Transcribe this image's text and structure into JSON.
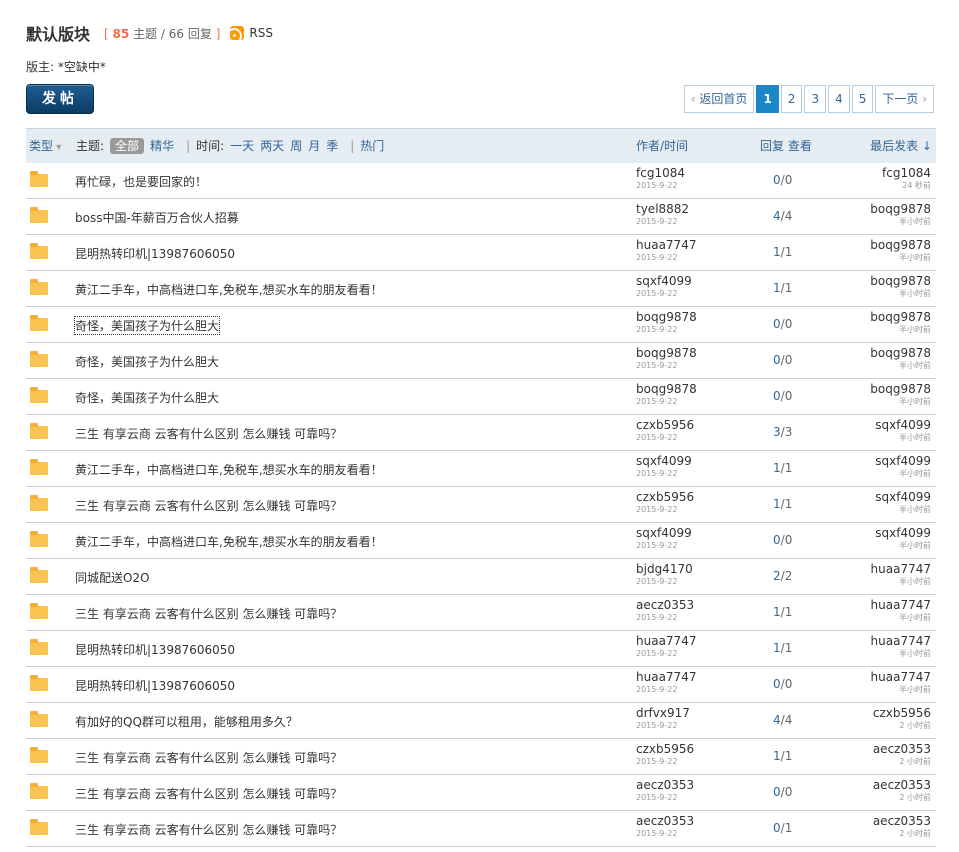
{
  "board": {
    "title": "默认版块",
    "stats_open": "[",
    "threads": "85",
    "threads_label": "主题",
    "stats_sep": "/",
    "replies": "66",
    "replies_label": "回复",
    "stats_close": "]",
    "rss": "RSS",
    "moderator": "版主: *空缺中*"
  },
  "post_button": "发帖",
  "pager": {
    "back": "返回首页",
    "current": "1",
    "pages": [
      "2",
      "3",
      "4",
      "5"
    ],
    "next": "下一页"
  },
  "header": {
    "type": "类型",
    "topic_label": "主题:",
    "all": "全部",
    "digest": "精华",
    "sep1": "|",
    "time_label": "时间:",
    "day": "一天",
    "two_days": "两天",
    "week": "周",
    "month": "月",
    "season": "季",
    "sep2": "|",
    "hot": "热门",
    "author_time": "作者/时间",
    "reply_view": "回复 查看",
    "last_post": "最后发表"
  },
  "rows": [
    {
      "subject": "再忙碌，也是要回家的！",
      "author": "fcg1084",
      "date": "2015-9-22",
      "replies": "0",
      "views": "0",
      "last_user": "fcg1084",
      "last_time": "24 秒前"
    },
    {
      "subject": "boss中国-年薪百万合伙人招募",
      "author": "tyel8882",
      "date": "2015-9-22",
      "replies": "4",
      "views": "4",
      "last_user": "boqg9878",
      "last_time": "半小时前"
    },
    {
      "subject": "昆明热转印机|13987606050",
      "author": "huaa7747",
      "date": "2015-9-22",
      "replies": "1",
      "views": "1",
      "last_user": "boqg9878",
      "last_time": "半小时前"
    },
    {
      "subject": "黄江二手车，中高档进口车,免税车,想买水车的朋友看看！",
      "author": "sqxf4099",
      "date": "2015-9-22",
      "replies": "1",
      "views": "1",
      "last_user": "boqg9878",
      "last_time": "半小时前"
    },
    {
      "subject": "奇怪，美国孩子为什么胆大",
      "author": "boqg9878",
      "date": "2015-9-22",
      "replies": "0",
      "views": "0",
      "last_user": "boqg9878",
      "last_time": "半小时前"
    },
    {
      "subject": "奇怪，美国孩子为什么胆大",
      "author": "boqg9878",
      "date": "2015-9-22",
      "replies": "0",
      "views": "0",
      "last_user": "boqg9878",
      "last_time": "半小时前"
    },
    {
      "subject": "奇怪，美国孩子为什么胆大",
      "author": "boqg9878",
      "date": "2015-9-22",
      "replies": "0",
      "views": "0",
      "last_user": "boqg9878",
      "last_time": "半小时前"
    },
    {
      "subject": "三生 有享云商 云客有什么区别 怎么赚钱 可靠吗？",
      "author": "czxb5956",
      "date": "2015-9-22",
      "replies": "3",
      "views": "3",
      "last_user": "sqxf4099",
      "last_time": "半小时前"
    },
    {
      "subject": "黄江二手车，中高档进口车,免税车,想买水车的朋友看看！",
      "author": "sqxf4099",
      "date": "2015-9-22",
      "replies": "1",
      "views": "1",
      "last_user": "sqxf4099",
      "last_time": "半小时前"
    },
    {
      "subject": "三生 有享云商 云客有什么区别 怎么赚钱 可靠吗？",
      "author": "czxb5956",
      "date": "2015-9-22",
      "replies": "1",
      "views": "1",
      "last_user": "sqxf4099",
      "last_time": "半小时前"
    },
    {
      "subject": "黄江二手车，中高档进口车,免税车,想买水车的朋友看看！",
      "author": "sqxf4099",
      "date": "2015-9-22",
      "replies": "0",
      "views": "0",
      "last_user": "sqxf4099",
      "last_time": "半小时前"
    },
    {
      "subject": "同城配送O2O",
      "author": "bjdg4170",
      "date": "2015-9-22",
      "replies": "2",
      "views": "2",
      "last_user": "huaa7747",
      "last_time": "半小时前"
    },
    {
      "subject": "三生 有享云商 云客有什么区别 怎么赚钱 可靠吗？",
      "author": "aecz0353",
      "date": "2015-9-22",
      "replies": "1",
      "views": "1",
      "last_user": "huaa7747",
      "last_time": "半小时前"
    },
    {
      "subject": "昆明热转印机|13987606050",
      "author": "huaa7747",
      "date": "2015-9-22",
      "replies": "1",
      "views": "1",
      "last_user": "huaa7747",
      "last_time": "半小时前"
    },
    {
      "subject": "昆明热转印机|13987606050",
      "author": "huaa7747",
      "date": "2015-9-22",
      "replies": "0",
      "views": "0",
      "last_user": "huaa7747",
      "last_time": "半小时前"
    },
    {
      "subject": "有加好的QQ群可以租用，能够租用多久？",
      "author": "drfvx917",
      "date": "2015-9-22",
      "replies": "4",
      "views": "4",
      "last_user": "czxb5956",
      "last_time": "2 小时前"
    },
    {
      "subject": "三生 有享云商 云客有什么区别 怎么赚钱 可靠吗？",
      "author": "czxb5956",
      "date": "2015-9-22",
      "replies": "1",
      "views": "1",
      "last_user": "aecz0353",
      "last_time": "2 小时前"
    },
    {
      "subject": "三生 有享云商 云客有什么区别 怎么赚钱 可靠吗？",
      "author": "aecz0353",
      "date": "2015-9-22",
      "replies": "0",
      "views": "0",
      "last_user": "aecz0353",
      "last_time": "2 小时前"
    },
    {
      "subject": "三生 有享云商 云客有什么区别 怎么赚钱 可靠吗？",
      "author": "aecz0353",
      "date": "2015-9-22",
      "replies": "0",
      "views": "1",
      "last_user": "aecz0353",
      "last_time": "2 小时前"
    }
  ]
}
